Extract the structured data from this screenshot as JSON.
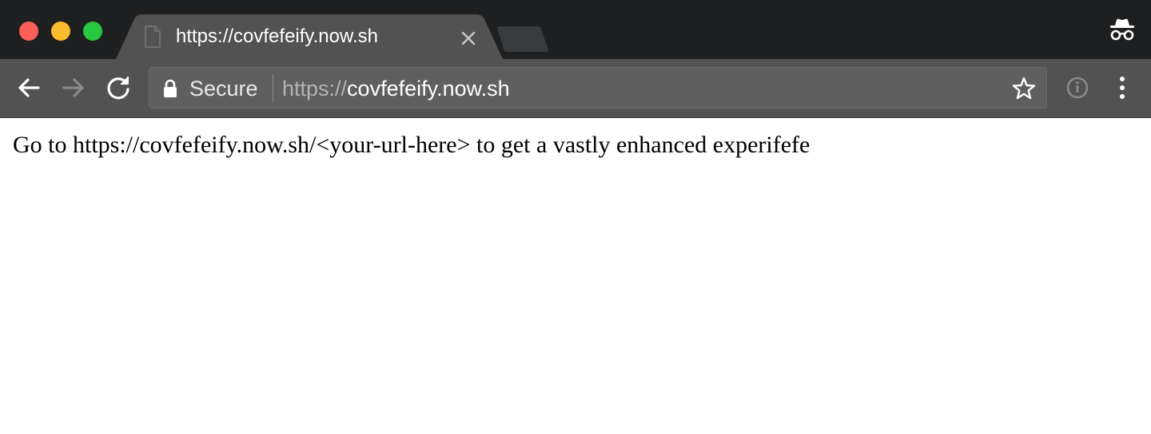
{
  "browser": {
    "tab": {
      "title": "https://covfefeify.now.sh",
      "icon": "document-icon"
    },
    "omnibox": {
      "security_label": "Secure",
      "url_scheme": "https://",
      "url_host": "covfefeify.now.sh"
    },
    "icons": {
      "back": "back-arrow-icon",
      "forward": "forward-arrow-icon",
      "reload": "reload-icon",
      "lock": "lock-icon",
      "bookmark": "star-icon",
      "extension": "info-icon",
      "menu": "vertical-dots-icon",
      "incognito": "incognito-icon"
    },
    "colors": {
      "tabstrip": "#1e1f21",
      "active_tab": "#525252",
      "toolbar": "#525252",
      "omnibox": "#5f5f5f",
      "close": "#fc5f57",
      "minimize": "#fdbc2e",
      "zoom": "#28c840"
    }
  },
  "page": {
    "text": "Go to https://covfefeify.now.sh/<your-url-here> to get a vastly enhanced experifefe"
  }
}
